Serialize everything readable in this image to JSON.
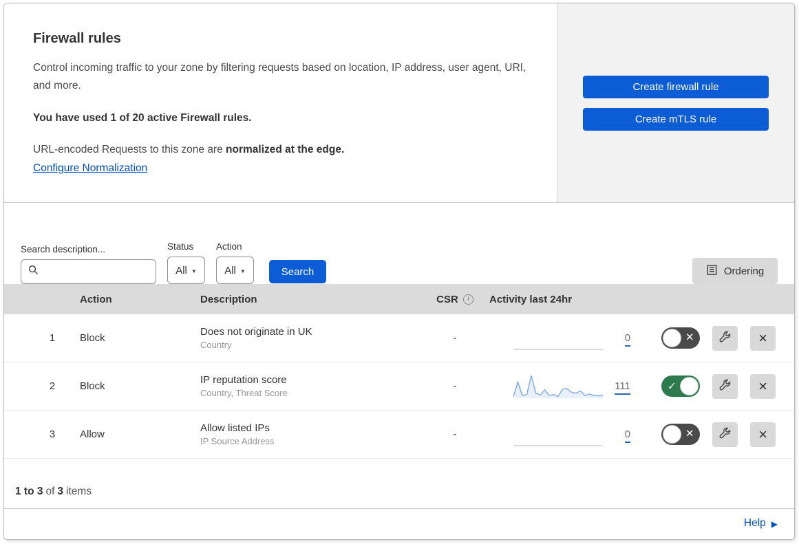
{
  "header": {
    "title": "Firewall rules",
    "description": "Control incoming traffic to your zone by filtering requests based on location, IP address, user agent, URI, and more.",
    "usage_note": "You have used 1 of 20 active Firewall rules.",
    "normalization_text": "URL-encoded Requests to this zone are",
    "normalization_bold": "normalized at the edge.",
    "normalization_link": "Configure Normalization"
  },
  "actions_panel": {
    "create_firewall_rule": "Create firewall rule",
    "create_mtls_rule": "Create mTLS rule"
  },
  "filters": {
    "search_label": "Search description...",
    "search_value": "",
    "status_label": "Status",
    "status_value": "All",
    "action_label": "Action",
    "action_value": "All",
    "search_button": "Search",
    "ordering_button": "Ordering"
  },
  "table": {
    "headers": {
      "action": "Action",
      "description": "Description",
      "csr": "CSR",
      "activity": "Activity last 24hr"
    },
    "rows": [
      {
        "num": "1",
        "action": "Block",
        "description": "Does not originate in UK",
        "fields": "Country",
        "csr": "-",
        "activity_count": "0",
        "enabled": false,
        "has_sparkline": false
      },
      {
        "num": "2",
        "action": "Block",
        "description": "IP reputation score",
        "fields": "Country, Threat Score",
        "csr": "-",
        "activity_count": "111",
        "enabled": true,
        "has_sparkline": true
      },
      {
        "num": "3",
        "action": "Allow",
        "description": "Allow listed IPs",
        "fields": "IP Source Address",
        "csr": "-",
        "activity_count": "0",
        "enabled": false,
        "has_sparkline": false
      }
    ]
  },
  "pagination": {
    "range": "1 to 3",
    "of": "of",
    "total": "3",
    "items": "items"
  },
  "help_link": "Help",
  "icons": {
    "search": "magnifier",
    "info": "i",
    "caret": "▼",
    "toggle_on_check": "✓",
    "toggle_off_x": "×",
    "delete_x": "×",
    "help_arrow": "▶"
  },
  "colors": {
    "accent_blue": "#0b5cd5",
    "link_blue": "#0051c3",
    "toggle_on_green": "#2d7a4d",
    "toggle_off_gray": "#4a4a4a",
    "panel_gray": "#f2f2f2",
    "table_header_gray": "#dbdbdb",
    "button_gray": "#d9d9d9",
    "sparkline_stroke": "#85aede",
    "sparkline_fill": "#e9effa",
    "flat_line_gray": "#c6c6c6"
  },
  "chart_data": {
    "type": "area",
    "title": "Activity last 24hr (rule 2 sparkline)",
    "x_range": "last 24 hours",
    "values": [
      5,
      70,
      9,
      13,
      100,
      21,
      11,
      35,
      9,
      13,
      5,
      38,
      40,
      24,
      20,
      30,
      9,
      16,
      9,
      8,
      9
    ],
    "ylim": [
      0,
      100
    ],
    "total": 111,
    "grid": false,
    "legend": false
  }
}
